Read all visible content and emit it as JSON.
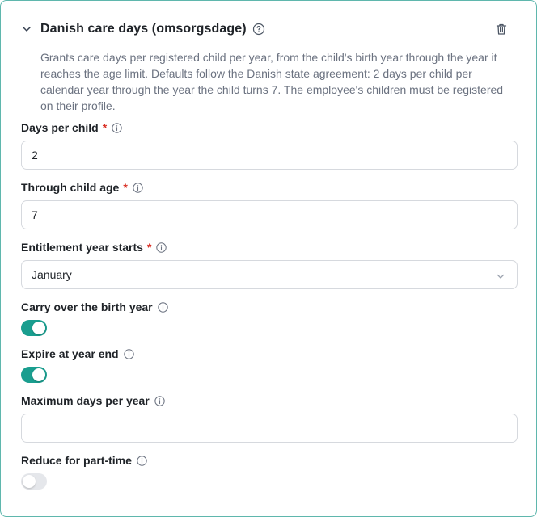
{
  "section": {
    "title": "Danish care days (omsorgsdage)",
    "description": "Grants care days per registered child per year, from the child's birth year through the year it reaches the age limit. Defaults follow the Danish state agreement: 2 days per child per calendar year through the year the child turns 7. The employee's children must be registered on their profile.",
    "icons": {
      "collapse": "chevron-down-icon",
      "help": "help-circle-icon",
      "delete": "trash-icon"
    }
  },
  "fields": {
    "days_per_child": {
      "label": "Days per child",
      "required_marker": "*",
      "value": "2"
    },
    "through_child_age": {
      "label": "Through child age",
      "required_marker": "*",
      "value": "7"
    },
    "entitlement_year_starts": {
      "label": "Entitlement year starts",
      "required_marker": "*",
      "value": "January"
    },
    "carry_over_birth_year": {
      "label": "Carry over the birth year",
      "enabled": true
    },
    "expire_at_year_end": {
      "label": "Expire at year end",
      "enabled": true
    },
    "maximum_days_per_year": {
      "label": "Maximum days per year",
      "value": ""
    },
    "reduce_for_part_time": {
      "label": "Reduce for part-time",
      "enabled": false
    }
  },
  "colors": {
    "accent": "#1a9e8f",
    "border_active": "#5fb7ad",
    "required": "#d93025"
  }
}
